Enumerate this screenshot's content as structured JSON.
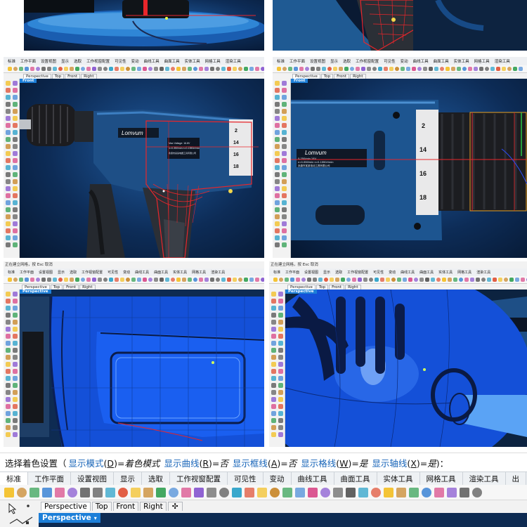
{
  "menu_tabs_small": [
    "标准",
    "工作平面",
    "设置视图",
    "显示",
    "选取",
    "工作视窗配置",
    "可见性",
    "变动",
    "曲线工具",
    "曲面工具",
    "实体工具",
    "网格工具",
    "渲染工具"
  ],
  "viewport_tabs": [
    "Perspective",
    "Top",
    "Front",
    "Right"
  ],
  "viewport_labels": {
    "mid_left": "Front",
    "mid_right": "Front",
    "low": "Perspective",
    "bottom": "Perspective"
  },
  "prompts": {
    "low_left": "正在建立网格，按 Esc 取消",
    "low_right": "正在建立网格，按 Esc 取消"
  },
  "drill": {
    "brand": "Lomvum",
    "ring_numbers": [
      "2",
      "14",
      "16",
      "18"
    ],
    "spec_lines": [
      "Max Voltage: 16.8V",
      "n=0-350/min n=0-1550/r/min",
      "永康市某某电器工具有限公司"
    ],
    "spec_lines_right": [
      "0-350/min 16V",
      "n=0-550/min n=0-1550/r/min",
      "永康市某某电动工具有限公司"
    ]
  },
  "command": {
    "prefix": "选择着色设置（",
    "items": [
      {
        "label": "显示模式",
        "key": "D",
        "value": "着色模式"
      },
      {
        "label": "显示曲线",
        "key": "R",
        "value": "否"
      },
      {
        "label": "显示框线",
        "key": "A",
        "value": "否"
      },
      {
        "label": "显示格线",
        "key": "W",
        "value": "是"
      },
      {
        "label": "显示轴线",
        "key": "X",
        "value": "是"
      }
    ],
    "suffix": ")："
  },
  "bottom_tabs": [
    "标准",
    "工作平面",
    "设置视图",
    "显示",
    "选取",
    "工作视窗配置",
    "可见性",
    "变动",
    "曲线工具",
    "曲面工具",
    "实体工具",
    "网格工具",
    "渲染工具",
    "出"
  ],
  "bottom_viewport_tabs": [
    "Perspective",
    "Top",
    "Front",
    "Right"
  ],
  "bottom_active_viewport": "Perspective",
  "colors": {
    "accent": "#1d7fd8",
    "model_blue": "#1450d8",
    "curve_red": "#e8262b",
    "bg_dark": "#0d2c57"
  }
}
